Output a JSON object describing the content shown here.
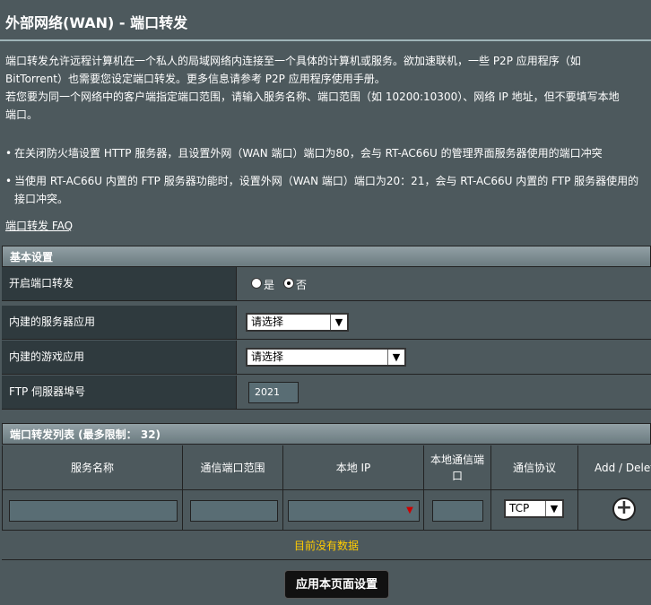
{
  "page": {
    "title": "外部网络(WAN) - 端口转发",
    "desc_lines": [
      "端口转发允许远程计算机在一个私人的局域网络内连接至一个具体的计算机或服务。欲加速联机，一些  P2P 应用程序（如",
      "BitTorrent）也需要您设定端口转发。更多信息请参考  P2P 应用程序使用手册。",
      "若您要为同一个网络中的客户端指定端口范围，请输入服务名称、端口范围（如  10200:10300）、网络  IP 地址，但不要填写本地",
      "端口。"
    ],
    "bullet1": "在关闭防火墙设置  HTTP 服务器，且设置外网（WAN 端口）端口为80，会与  RT-AC66U 的管理界面服务器使用的端口冲突",
    "bullet2": "当使用  RT-AC66U 内置的  FTP 服务器功能时，设置外网（WAN 端口）端口为20：21，会与  RT-AC66U 内置的  FTP 服务器使用的接口冲突。",
    "faq_link": "端口转发  FAQ"
  },
  "basic": {
    "header": "基本设置",
    "enable_label": "开启端口转发",
    "yes": "是",
    "no": "否",
    "enabled_choice": "否",
    "server_app_label": "内建的服务器应用",
    "server_app_value": "请选择",
    "game_app_label": "内建的游戏应用",
    "game_app_value": "请选择",
    "ftp_label": "FTP 伺服器埠号",
    "ftp_value": "2021"
  },
  "list": {
    "header": "端口转发列表 (最多限制： 32)",
    "columns": [
      "服务名称",
      "通信端口范围",
      "本地  IP",
      "本地通信端口",
      "通信协议",
      "Add / Delete"
    ],
    "protocol_value": "TCP",
    "empty_text": "目前没有数据"
  },
  "apply_button": "应用本页面设置",
  "icons": {
    "add": "plus-circle-icon",
    "dropdown": "chevron-down-icon"
  }
}
